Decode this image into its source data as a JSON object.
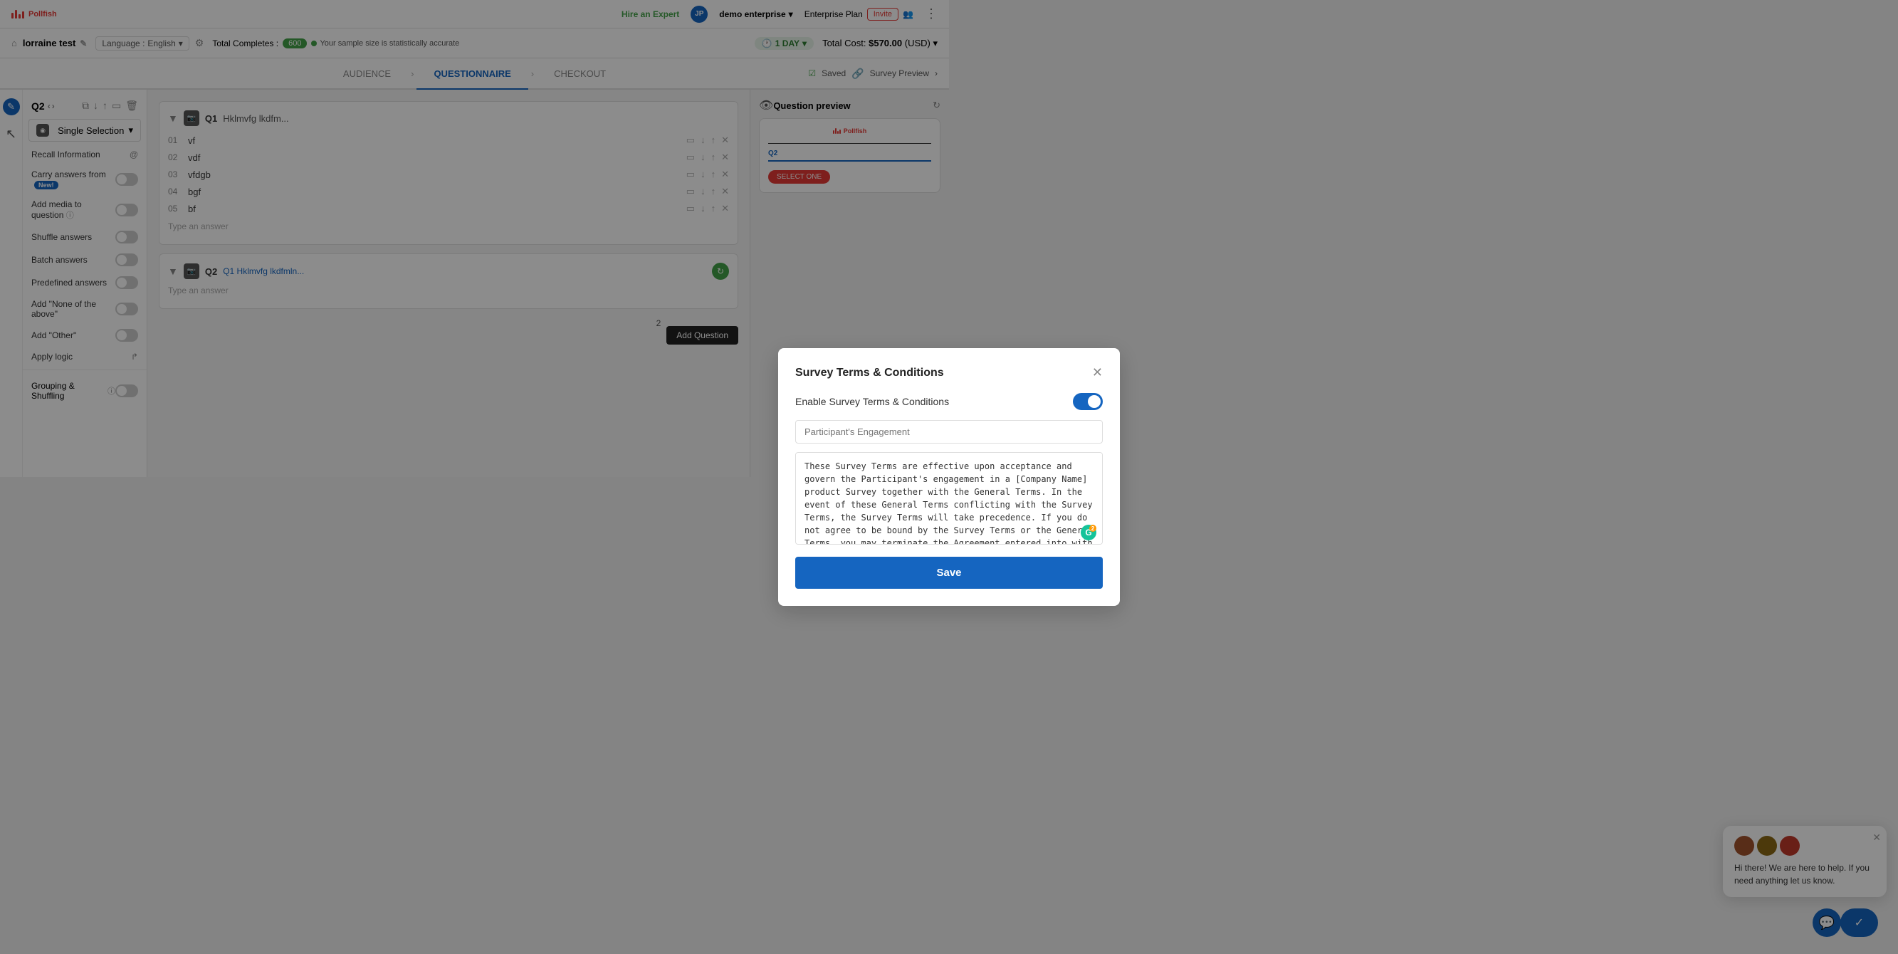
{
  "app": {
    "name": "Pollfish",
    "logo_alt": "Pollfish logo"
  },
  "topnav": {
    "hire_expert": "Hire an Expert",
    "user_initial": "JP",
    "username": "demo enterprise",
    "plan": "Enterprise Plan",
    "invite": "Invite"
  },
  "survey_header": {
    "title": "lorraine test",
    "language_label": "Language :",
    "language": "English",
    "completes_label": "Total Completes :",
    "completes_value": "600",
    "sample_note": "Your sample size is statistically accurate",
    "day_selector": "1 DAY",
    "total_cost_label": "Total Cost:",
    "total_cost_value": "$570.00",
    "total_cost_currency": "(USD)"
  },
  "tabs": {
    "audience": "AUDIENCE",
    "questionnaire": "QUESTIONNAIRE",
    "checkout": "CHECKOUT",
    "saved": "Saved",
    "survey_preview": "Survey Preview"
  },
  "sidebar": {
    "q_label": "Q2",
    "type_label": "Single Selection",
    "options": [
      {
        "label": "Recall Information",
        "icon": "@",
        "toggle": false,
        "has_icon": true
      },
      {
        "label": "Carry answers from",
        "badge": "New!",
        "toggle": false
      },
      {
        "label": "Add media to question",
        "info": true,
        "toggle": false
      },
      {
        "label": "Shuffle answers",
        "toggle": false
      },
      {
        "label": "Batch answers",
        "toggle": false
      },
      {
        "label": "Predefined answers",
        "toggle": false
      },
      {
        "label": "Add \"None of the above\"",
        "toggle": false
      },
      {
        "label": "Add \"Other\"",
        "toggle": false
      },
      {
        "label": "Apply logic",
        "toggle": false,
        "arrow": true
      }
    ],
    "grouping_label": "Grouping & Shuffling"
  },
  "questions": {
    "q1": {
      "label": "Q1",
      "text": "Hklmvfg lkdfm...",
      "answers": [
        {
          "num": "01",
          "text": "vf"
        },
        {
          "num": "02",
          "text": "vdf"
        },
        {
          "num": "03",
          "text": "vfdgb"
        },
        {
          "num": "04",
          "text": "bgf"
        },
        {
          "num": "05",
          "text": "bf"
        }
      ],
      "add_answer_placeholder": "Type an answer"
    },
    "q2": {
      "label": "Q2",
      "q1_ref": "Q1 Hklmvfg lkdfmln...",
      "add_answer_placeholder": "Type an answer"
    }
  },
  "right_panel": {
    "title": "Question preview",
    "q2_label": "Q2",
    "select_btn": "SELECT ONE",
    "add_question_btn": "Add Question"
  },
  "modal": {
    "title": "Survey Terms & Conditions",
    "toggle_label": "Enable Survey Terms & Conditions",
    "toggle_on": true,
    "input_placeholder": "Participant's Engagement",
    "textarea_content": "These Survey Terms are effective upon acceptance and govern the Participant's engagement in a [Company Name] product Survey together with the General Terms. In the event of these General Terms conflicting with the Survey Terms, the Survey Terms will take precedence. If you do not agree to be bound by the Survey Terms or the General Terms, you may terminate the Agreement entered into with [Company Name]  at any time by sending an email to legal@companyname.com.",
    "save_btn": "Save"
  },
  "chat": {
    "message": "Hi there! We are here to help. If you need anything let us know.",
    "confirm_icon": "✓"
  }
}
